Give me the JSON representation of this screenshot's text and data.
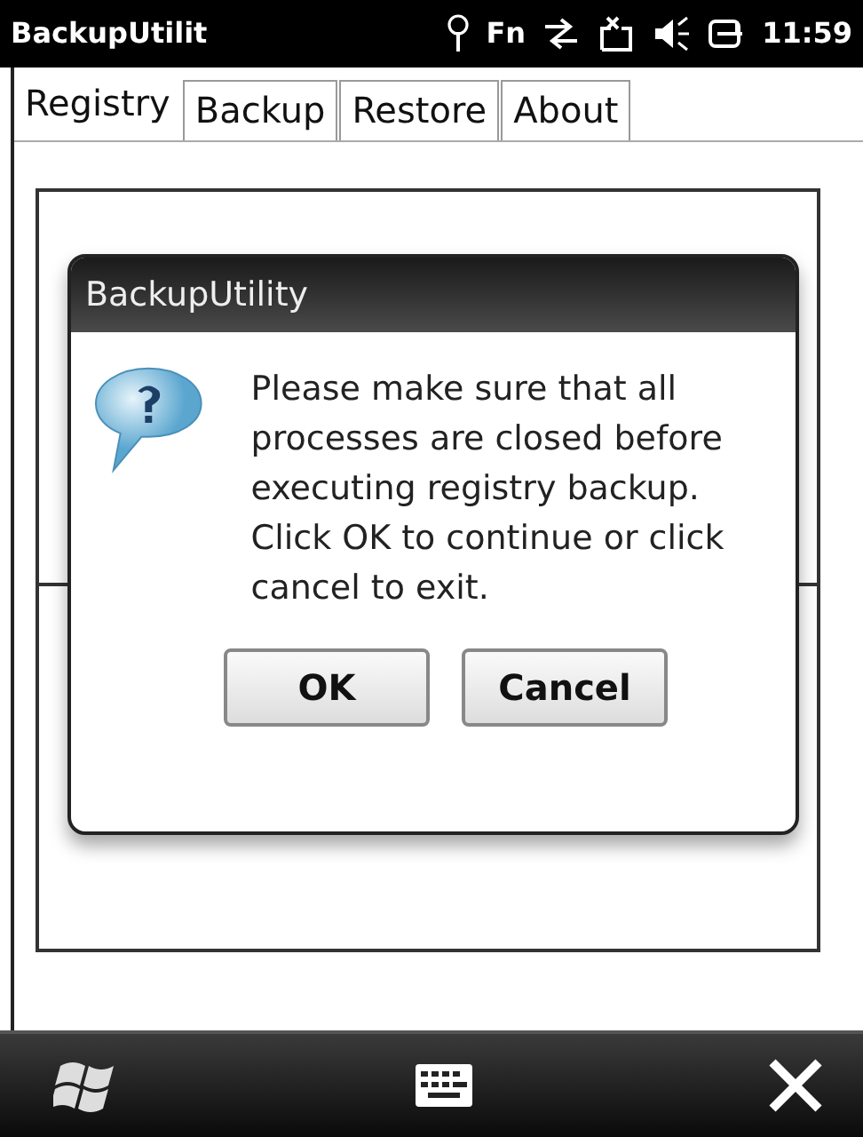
{
  "status_bar": {
    "title": "BackupUtilit",
    "fn": "Fn",
    "time": "11:59"
  },
  "tabs": [
    {
      "label": "Registry",
      "selected": true
    },
    {
      "label": "Backup",
      "selected": false
    },
    {
      "label": "Restore",
      "selected": false
    },
    {
      "label": "About",
      "selected": false
    }
  ],
  "dialog": {
    "title": "BackupUtility",
    "message": "Please make sure that all processes are closed before executing registry backup. Click OK to continue or click cancel to exit.",
    "buttons": [
      {
        "label": "OK"
      },
      {
        "label": "Cancel"
      }
    ]
  }
}
